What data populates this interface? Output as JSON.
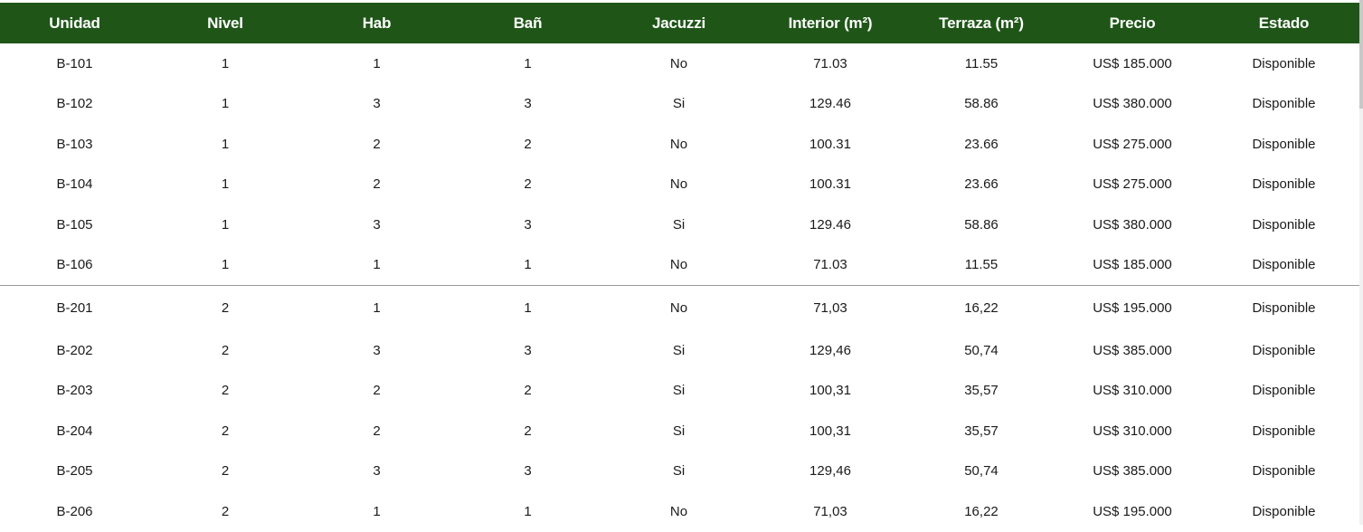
{
  "table": {
    "columns": [
      "Unidad",
      "Nivel",
      "Hab",
      "Bañ",
      "Jacuzzi",
      "Interior (m²)",
      "Terraza (m²)",
      "Precio",
      "Estado"
    ],
    "rows": [
      [
        "B-101",
        "1",
        "1",
        "1",
        "No",
        "71.03",
        "11.55",
        "US$ 185.000",
        "Disponible"
      ],
      [
        "B-102",
        "1",
        "3",
        "3",
        "Si",
        "129.46",
        "58.86",
        "US$ 380.000",
        "Disponible"
      ],
      [
        "B-103",
        "1",
        "2",
        "2",
        "No",
        "100.31",
        "23.66",
        "US$ 275.000",
        "Disponible"
      ],
      [
        "B-104",
        "1",
        "2",
        "2",
        "No",
        "100.31",
        "23.66",
        "US$ 275.000",
        "Disponible"
      ],
      [
        "B-105",
        "1",
        "3",
        "3",
        "Si",
        "129.46",
        "58.86",
        "US$ 380.000",
        "Disponible"
      ],
      [
        "B-106",
        "1",
        "1",
        "1",
        "No",
        "71.03",
        "11.55",
        "US$ 185.000",
        "Disponible"
      ],
      [
        "B-201",
        "2",
        "1",
        "1",
        "No",
        "71,03",
        "16,22",
        "US$ 195.000",
        "Disponible"
      ],
      [
        "B-202",
        "2",
        "3",
        "3",
        "Si",
        "129,46",
        "50,74",
        "US$ 385.000",
        "Disponible"
      ],
      [
        "B-203",
        "2",
        "2",
        "2",
        "Si",
        "100,31",
        "35,57",
        "US$ 310.000",
        "Disponible"
      ],
      [
        "B-204",
        "2",
        "2",
        "2",
        "Si",
        "100,31",
        "35,57",
        "US$ 310.000",
        "Disponible"
      ],
      [
        "B-205",
        "2",
        "3",
        "3",
        "Si",
        "129,46",
        "50,74",
        "US$ 385.000",
        "Disponible"
      ],
      [
        "B-206",
        "2",
        "1",
        "1",
        "No",
        "71,03",
        "16,22",
        "US$ 195.000",
        "Disponible"
      ]
    ]
  },
  "colors": {
    "header_bg": "#1f5618",
    "header_text": "#ffffff",
    "body_text": "#1a1a1a",
    "separator": "#9a9a9a"
  }
}
